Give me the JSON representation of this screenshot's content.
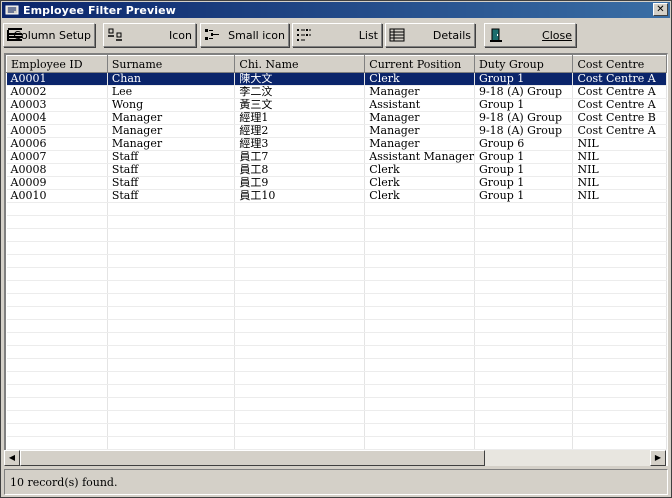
{
  "window": {
    "title": "Employee Filter Preview",
    "close_glyph": "✕"
  },
  "toolbar": {
    "column_setup": "Column Setup",
    "icon": "Icon",
    "small_icon": "Small icon",
    "list": "List",
    "details": "Details",
    "close": "Close"
  },
  "table": {
    "columns": [
      "Employee ID",
      "Surname",
      "Chi. Name",
      "Current Position",
      "Duty Group",
      "Cost Centre"
    ],
    "rows": [
      [
        "A0001",
        "Chan",
        "陳大文",
        "Clerk",
        "Group 1",
        "Cost Centre A"
      ],
      [
        "A0002",
        "Lee",
        "李二汶",
        "Manager",
        "9-18 (A) Group",
        "Cost Centre A"
      ],
      [
        "A0003",
        "Wong",
        "黃三文",
        "Assistant",
        "Group 1",
        "Cost Centre A"
      ],
      [
        "A0004",
        "Manager",
        "經理1",
        "Manager",
        "9-18 (A) Group",
        "Cost Centre B"
      ],
      [
        "A0005",
        "Manager",
        "經理2",
        "Manager",
        "9-18 (A) Group",
        "Cost Centre A"
      ],
      [
        "A0006",
        "Manager",
        "經理3",
        "Manager",
        "Group 6",
        "NIL"
      ],
      [
        "A0007",
        "Staff",
        "員工7",
        "Assistant Manager",
        "Group 1",
        "NIL"
      ],
      [
        "A0008",
        "Staff",
        "員工8",
        "Clerk",
        "Group 1",
        "NIL"
      ],
      [
        "A0009",
        "Staff",
        "員工9",
        "Clerk",
        "Group 1",
        "NIL"
      ],
      [
        "A0010",
        "Staff",
        "員工10",
        "Clerk",
        "Group 1",
        "NIL"
      ]
    ],
    "selected_row": 0
  },
  "scrollbar": {
    "left_arrow": "◀",
    "right_arrow": "▶"
  },
  "status": {
    "text": "10 record(s) found."
  },
  "colors": {
    "selection": "#0a246a",
    "title_gradient_start": "#0a246a",
    "title_gradient_end": "#3a6ea5",
    "face": "#d4d0c8"
  }
}
